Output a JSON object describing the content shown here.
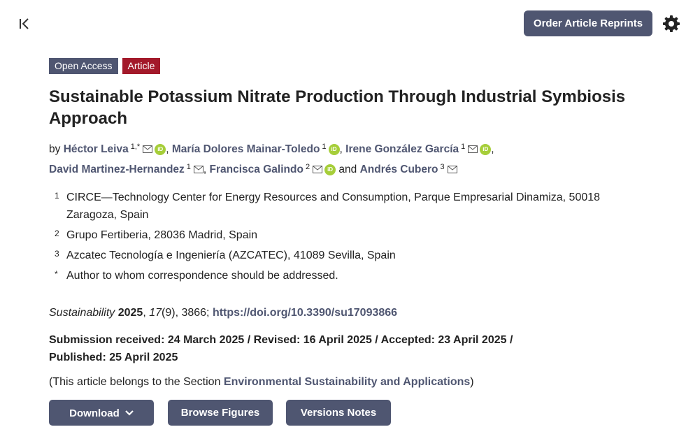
{
  "header": {
    "reprints_label": "Order Article Reprints",
    "collapse_icon": "collapse-left-icon",
    "settings_icon": "gear-icon"
  },
  "badges": {
    "open_access": "Open Access",
    "type": "Article"
  },
  "title": "Sustainable Potassium Nitrate Production Through Industrial Symbiosis Approach",
  "authors": {
    "by": "by",
    "list": [
      {
        "name": "Héctor Leiva",
        "sup": "1,*"
      },
      {
        "name": "María Dolores Mainar-Toledo",
        "sup": "1"
      },
      {
        "name": "Irene González García",
        "sup": "1"
      },
      {
        "name": "David Martinez-Hernandez",
        "sup": "1"
      },
      {
        "name": "Francisca Galindo",
        "sup": "2"
      },
      {
        "name": "Andrés Cubero",
        "sup": "3"
      }
    ],
    "sep": ",",
    "and": "and"
  },
  "affiliations": [
    {
      "num": "1",
      "text": "CIRCE—Technology Center for Energy Resources and Consumption, Parque Empresarial Dinamiza, 50018 Zaragoza, Spain"
    },
    {
      "num": "2",
      "text": "Grupo Fertiberia, 28036 Madrid, Spain"
    },
    {
      "num": "3",
      "text": "Azcatec Tecnología e Ingeniería (AZCATEC), 41089 Sevilla, Spain"
    },
    {
      "num": "*",
      "text": "Author to whom correspondence should be addressed."
    }
  ],
  "citation": {
    "journal": "Sustainability",
    "year": "2025",
    "sep1": ", ",
    "volume": "17",
    "issue_pages": "(9), 3866; ",
    "doi": "https://doi.org/10.3390/su17093866"
  },
  "dates": "Submission received: 24 March 2025 / Revised: 16 April 2025 / Accepted: 23 April 2025 / Published: 25 April 2025",
  "section": {
    "prefix": "(This article belongs to the Section ",
    "name": "Environmental Sustainability and Applications",
    "suffix": ")"
  },
  "actions": {
    "download": "Download",
    "browse_figures": "Browse Figures",
    "versions_notes": "Versions Notes"
  },
  "colors": {
    "primary": "#4f5671",
    "article_badge": "#a3192a",
    "orcid": "#a6ce39"
  }
}
